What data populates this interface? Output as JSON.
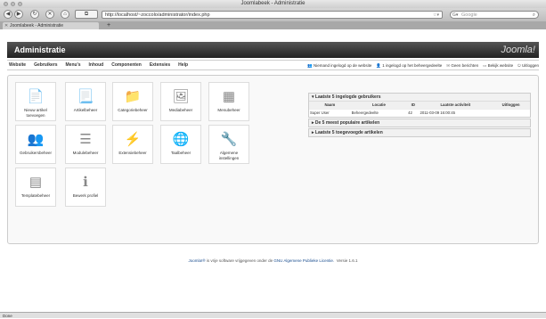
{
  "browser": {
    "window_title": "Joomlabeek - Administratie",
    "url": "http://localhost/~zoccolo/administrator/index.php",
    "search_placeholder": "Google",
    "tab_title": "Joomlabeek - Administratie",
    "new_tab_label": "+",
    "status_text": "Done"
  },
  "admin": {
    "title": "Administratie",
    "logo_text": "Joomla!",
    "menu": [
      "Website",
      "Gebruikers",
      "Menu's",
      "Inhoud",
      "Componenten",
      "Extensies",
      "Help"
    ],
    "status": {
      "frontend_users": "Niemand ingelogd op de website",
      "backend_users": "1 ingelogd op het beheergedeelte",
      "messages": "Geen berichten",
      "view_site": "Bekijk website",
      "logout": "Uitloggen"
    }
  },
  "quickicons": [
    {
      "label": "Nieuw artikel toevoegen",
      "icon": "new-article-icon",
      "glyph": "📄"
    },
    {
      "label": "Artikelbeheer",
      "icon": "article-icon",
      "glyph": "📃"
    },
    {
      "label": "Categoriebeheer",
      "icon": "folder-icon",
      "glyph": "📁"
    },
    {
      "label": "Mediabeheer",
      "icon": "media-icon",
      "glyph": "🖼"
    },
    {
      "label": "Menubeheer",
      "icon": "menu-icon",
      "glyph": "▦"
    },
    {
      "label": "Gebruikersbeheer",
      "icon": "users-icon",
      "glyph": "👥"
    },
    {
      "label": "Modulebeheer",
      "icon": "module-icon",
      "glyph": "☰"
    },
    {
      "label": "Extensiebeheer",
      "icon": "extension-icon",
      "glyph": "⚡"
    },
    {
      "label": "Taalbeheer",
      "icon": "language-icon",
      "glyph": "🌐"
    },
    {
      "label": "Algemene instellingen",
      "icon": "settings-icon",
      "glyph": "🔧"
    },
    {
      "label": "Templatebeheer",
      "icon": "template-icon",
      "glyph": "▤"
    },
    {
      "label": "Bewerk profiel",
      "icon": "profile-icon",
      "glyph": "ℹ"
    }
  ],
  "modules": {
    "logged_in": {
      "title": "▾ Laatste 5 ingelogde gebruikers",
      "headers": [
        "Naam",
        "Locatie",
        "ID",
        "Laatste activiteit",
        "Uitloggen"
      ],
      "rows": [
        [
          "Super User",
          "Beheergedeelte",
          "42",
          "2011-03-09 16:00:45",
          ""
        ]
      ]
    },
    "popular": {
      "title": "▸ De 5 meest populaire artikelen"
    },
    "recent": {
      "title": "▸ Laatste 5 toegevoegde artikelen"
    }
  },
  "footer": {
    "part1": "Joomla!®",
    "part2": " is vrije software vrijgegeven onder de ",
    "license": "GNU Algemene Publieke Licentie.",
    "version": "Versie 1.6.1"
  }
}
